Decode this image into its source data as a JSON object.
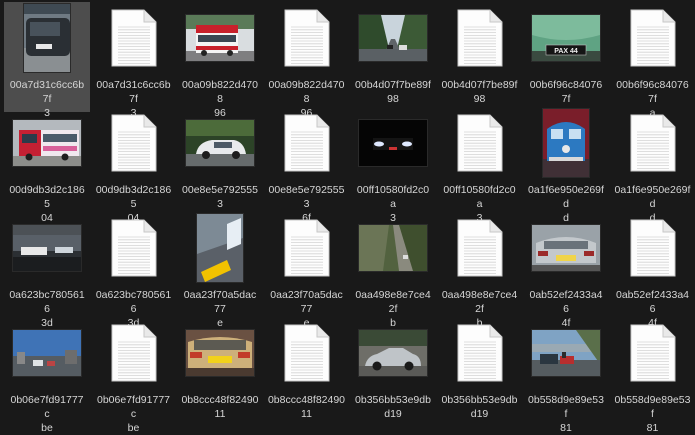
{
  "files": [
    {
      "name": "00a7d31c6cc6b7f3",
      "kind": "image",
      "scene": "dark-hatchback",
      "selected": true
    },
    {
      "name": "00a7d31c6cc6b7f3",
      "kind": "text"
    },
    {
      "name": "00a09b822d470896",
      "kind": "image",
      "scene": "red-bus-white"
    },
    {
      "name": "00a09b822d470896",
      "kind": "text"
    },
    {
      "name": "00b4d07f7be89f98",
      "kind": "image",
      "scene": "tree-lined-road"
    },
    {
      "name": "00b4d07f7be89f98",
      "kind": "text"
    },
    {
      "name": "00b6f96c840767fa",
      "kind": "image",
      "scene": "green-car-plate",
      "plate": "PAX 44"
    },
    {
      "name": "00b6f96c840767fa",
      "kind": "text"
    },
    {
      "name": "00d9db3d2c186504",
      "kind": "image",
      "scene": "red-bus-side"
    },
    {
      "name": "00d9db3d2c186504",
      "kind": "text"
    },
    {
      "name": "00e8e5e79255536f",
      "kind": "image",
      "scene": "white-sedan-trees"
    },
    {
      "name": "00e8e5e79255536f",
      "kind": "text"
    },
    {
      "name": "00ff10580fd2c0a3",
      "kind": "image",
      "scene": "night-headlights"
    },
    {
      "name": "00ff10580fd2c0a3",
      "kind": "text"
    },
    {
      "name": "0a1f6e950e269fdd",
      "kind": "image",
      "scene": "blue-vw-van"
    },
    {
      "name": "0a1f6e950e269fdd",
      "kind": "text"
    },
    {
      "name": "0a623bc78056163d",
      "kind": "image",
      "scene": "car-plate-closeup"
    },
    {
      "name": "0a623bc78056163d",
      "kind": "text"
    },
    {
      "name": "0aa23f70a5dac77e",
      "kind": "image",
      "scene": "yellow-plate-tilted"
    },
    {
      "name": "0aa23f70a5dac77e",
      "kind": "text"
    },
    {
      "name": "0aa498e8e7ce42fb",
      "kind": "image",
      "scene": "cliff-road"
    },
    {
      "name": "0aa498e8e7ce42fb",
      "kind": "text"
    },
    {
      "name": "0ab52ef2433a464f",
      "kind": "image",
      "scene": "silver-car-rear"
    },
    {
      "name": "0ab52ef2433a464f",
      "kind": "text"
    },
    {
      "name": "0b06e7fd91777cbe",
      "kind": "image",
      "scene": "city-street-sky"
    },
    {
      "name": "0b06e7fd91777cbe",
      "kind": "text"
    },
    {
      "name": "0b8ccc48f8249011",
      "kind": "image",
      "scene": "gold-car-rear"
    },
    {
      "name": "0b8ccc48f8249011",
      "kind": "text"
    },
    {
      "name": "0b356bb53e9dbd19",
      "kind": "image",
      "scene": "silver-convertible"
    },
    {
      "name": "0b356bb53e9dbd19",
      "kind": "text"
    },
    {
      "name": "0b558d9e89e53f81",
      "kind": "image",
      "scene": "parked-cars-coast"
    },
    {
      "name": "0b558d9e89e53f81",
      "kind": "text"
    }
  ],
  "labels": [
    "00a7d31c6cc6b7f\n3",
    "00a7d31c6cc6b7f\n3",
    "00a09b822d4708\n96",
    "00a09b822d4708\n96",
    "00b4d07f7be89f\n98",
    "00b4d07f7be89f\n98",
    "00b6f96c840767f\na",
    "00b6f96c840767f\na",
    "00d9db3d2c1865\n04",
    "00d9db3d2c1865\n04",
    "00e8e5e7925553\n6f",
    "00e8e5e7925553\n6f",
    "00ff10580fd2c0a\n3",
    "00ff10580fd2c0a\n3",
    "0a1f6e950e269fd\nd",
    "0a1f6e950e269fd\nd",
    "0a623bc7805616\n3d",
    "0a623bc7805616\n3d",
    "0aa23f70a5dac77\ne",
    "0aa23f70a5dac77\ne",
    "0aa498e8e7ce42f\nb",
    "0aa498e8e7ce42f\nb",
    "0ab52ef2433a46\n4f",
    "0ab52ef2433a46\n4f",
    "0b06e7fd91777c\nbe",
    "0b06e7fd91777c\nbe",
    "0b8ccc48f82490\n11",
    "0b8ccc48f82490\n11",
    "0b356bb53e9db\nd19",
    "0b356bb53e9db\nd19",
    "0b558d9e89e53f\n81",
    "0b558d9e89e53f\n81"
  ],
  "colors": {
    "background": "#191919",
    "selection": "#4d4d4d",
    "label": "#d6d6d6"
  }
}
